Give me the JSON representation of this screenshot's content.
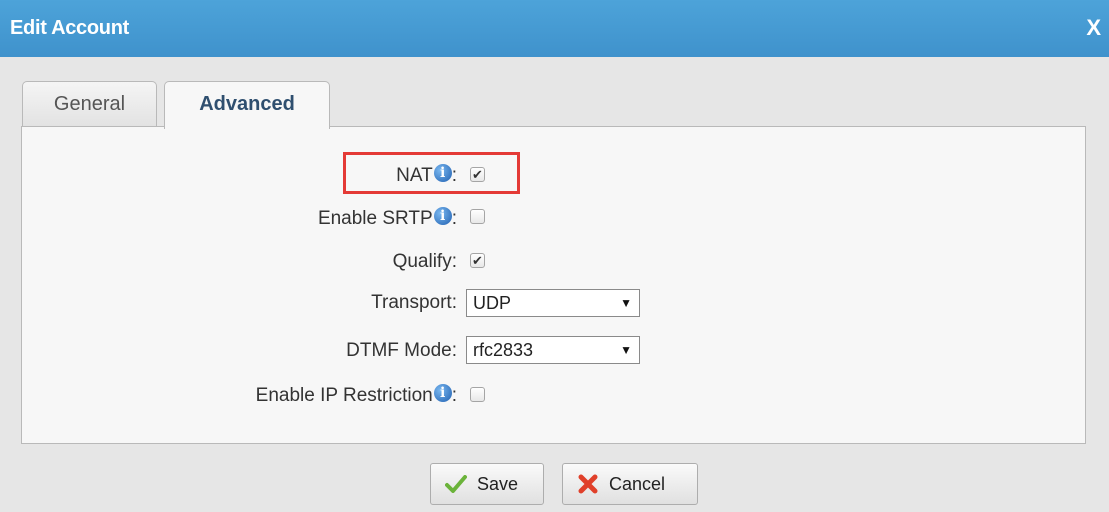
{
  "dialog": {
    "title": "Edit Account",
    "close_label": "X"
  },
  "tabs": [
    {
      "label": "General",
      "active": false
    },
    {
      "label": "Advanced",
      "active": true
    }
  ],
  "fields": {
    "nat": {
      "label": "NAT",
      "suffix": ":",
      "checked": true
    },
    "srtp": {
      "label": "Enable SRTP",
      "suffix": ":",
      "checked": false
    },
    "qualify": {
      "label": "Qualify:",
      "checked": true
    },
    "transport": {
      "label": "Transport:",
      "value": "UDP"
    },
    "dtmf": {
      "label": "DTMF Mode:",
      "value": "rfc2833"
    },
    "ip_restriction": {
      "label": "Enable IP Restriction",
      "suffix": ":",
      "checked": false
    }
  },
  "buttons": {
    "save": "Save",
    "cancel": "Cancel"
  },
  "icons": {
    "info": "info-icon",
    "check": "checkmark-icon",
    "cancel": "x-icon"
  },
  "colors": {
    "titlebar": "#3f92cc",
    "highlight": "#e43a36",
    "info": "#1f5fb0"
  }
}
